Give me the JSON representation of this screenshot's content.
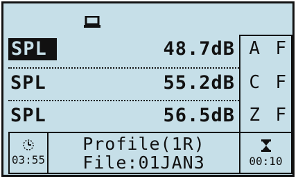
{
  "top_icon": "laptop-icon",
  "rows": [
    {
      "label": "SPL",
      "value": "48.7dB",
      "weight_freq": "A",
      "weight_time": "F",
      "selected": true
    },
    {
      "label": "SPL",
      "value": "55.2dB",
      "weight_freq": "C",
      "weight_time": "F",
      "selected": false
    },
    {
      "label": "SPL",
      "value": "56.5dB",
      "weight_freq": "Z",
      "weight_time": "F",
      "selected": false
    }
  ],
  "footer": {
    "elapsed_icon": "clock-icon",
    "elapsed_time": "03:55",
    "profile": "Profile(1R)",
    "file": "File:01JAN3",
    "timer_icon": "hourglass-icon",
    "timer_value": "00:10"
  }
}
